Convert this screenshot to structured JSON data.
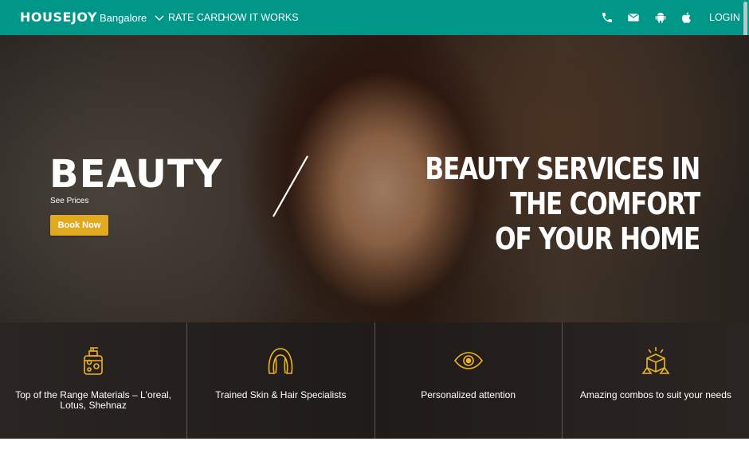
{
  "nav": {
    "logo": "HOUSEJOY",
    "city": "Bangalore",
    "links": [
      "RATE CARD",
      "HOW IT WORKS"
    ],
    "icons": [
      "phone-icon",
      "mail-icon",
      "android-icon",
      "apple-icon"
    ],
    "login": "LOGIN",
    "color": "#009688"
  },
  "hero": {
    "title": "BEAUTY",
    "see_prices": "See Prices",
    "book_now": "Book Now",
    "tagline_line1": "BEAUTY SERVICES IN THE COMFORT",
    "tagline_line2": "OF YOUR HOME",
    "button_color": "#e0a91f"
  },
  "features": [
    {
      "icon": "beauty-products-icon",
      "text": "Top of the Range Materials – L'oreal, Lotus, Shehnaz"
    },
    {
      "icon": "hair-icon",
      "text": "Trained Skin & Hair Specialists"
    },
    {
      "icon": "eye-icon",
      "text": "Personalized attention"
    },
    {
      "icon": "combo-box-icon",
      "text": "Amazing combos to suit your needs"
    }
  ],
  "accent_color": "#f0b41e"
}
